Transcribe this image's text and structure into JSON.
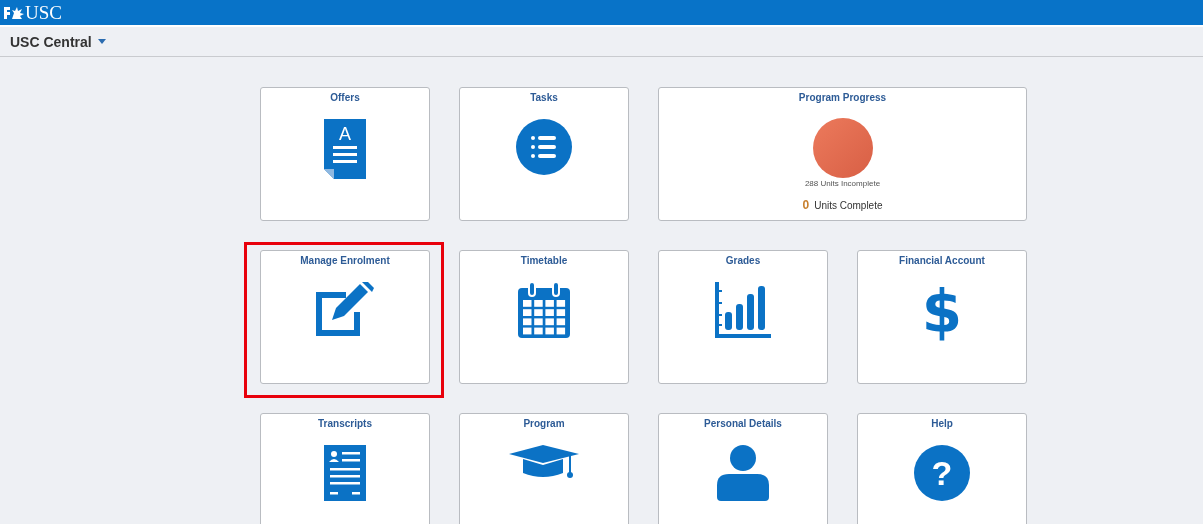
{
  "brand": {
    "logo": "USC"
  },
  "header": {
    "title": "USC Central"
  },
  "tiles": [
    {
      "kind": "icon",
      "title": "Offers",
      "highlighted": false,
      "icon_text": "A"
    },
    {
      "kind": "icon",
      "title": "Tasks",
      "highlighted": false
    },
    {
      "kind": "progress",
      "title": "Program Progress",
      "highlighted": false,
      "incomplete_label": "288 Units Incomplete",
      "complete_count": "0",
      "complete_label": "Units Complete"
    },
    {
      "kind": "icon",
      "title": "Manage Enrolment",
      "highlighted": true
    },
    {
      "kind": "icon",
      "title": "Timetable",
      "highlighted": false
    },
    {
      "kind": "icon",
      "title": "Grades",
      "highlighted": false
    },
    {
      "kind": "icon",
      "title": "Financial Account",
      "highlighted": false,
      "icon_text": "$"
    },
    {
      "kind": "icon",
      "title": "Transcripts",
      "highlighted": false
    },
    {
      "kind": "icon",
      "title": "Program",
      "highlighted": false
    },
    {
      "kind": "icon",
      "title": "Personal Details",
      "highlighted": false
    },
    {
      "kind": "icon",
      "title": "Help",
      "highlighted": false,
      "icon_text": "?"
    }
  ]
}
